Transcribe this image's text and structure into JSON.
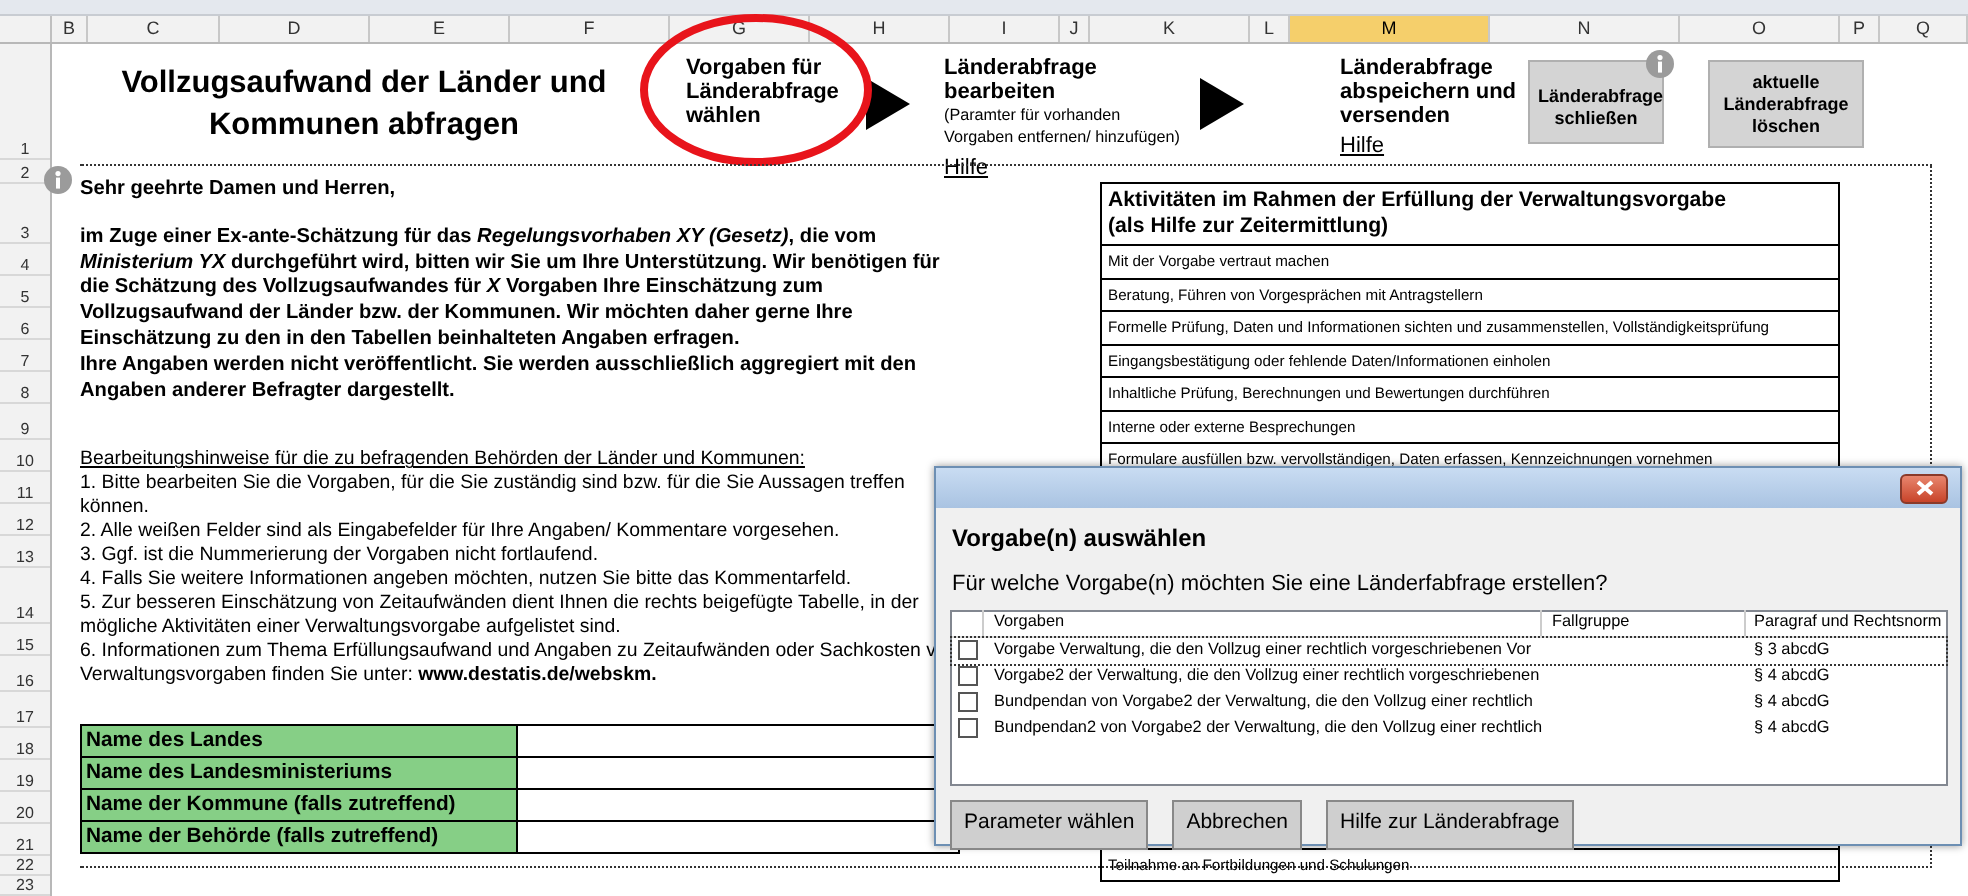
{
  "column_headers": [
    {
      "label": "B",
      "selected": false
    },
    {
      "label": "C",
      "selected": false
    },
    {
      "label": "D",
      "selected": false
    },
    {
      "label": "E",
      "selected": false
    },
    {
      "label": "F",
      "selected": false
    },
    {
      "label": "G",
      "selected": false
    },
    {
      "label": "H",
      "selected": false
    },
    {
      "label": "I",
      "selected": false
    },
    {
      "label": "J",
      "selected": false
    },
    {
      "label": "K",
      "selected": false
    },
    {
      "label": "L",
      "selected": false
    },
    {
      "label": "M",
      "selected": true
    },
    {
      "label": "N",
      "selected": false
    },
    {
      "label": "O",
      "selected": false
    },
    {
      "label": "P",
      "selected": false
    },
    {
      "label": "Q",
      "selected": false
    }
  ],
  "row_numbers": [
    "1",
    "2",
    "3",
    "4",
    "5",
    "6",
    "7",
    "8",
    "9",
    "10",
    "11",
    "12",
    "13",
    "14",
    "15",
    "16",
    "17",
    "18",
    "19",
    "20",
    "21",
    "22",
    "23"
  ],
  "header": {
    "title": "Vollzugsaufwand der Länder und Kommunen abfragen",
    "steps": [
      {
        "title": "Vorgaben für Länderabfrage wählen",
        "highlighted": true
      },
      {
        "title": "Länderabfrage bearbeiten",
        "subtitle": "(Paramter für vorhanden Vorgaben entfernen/ hinzufügen)",
        "link": "Hilfe",
        "highlighted": false
      },
      {
        "title": "Länderabfrage abspeichern und versenden",
        "link": "Hilfe",
        "highlighted": false
      }
    ],
    "buttons": [
      {
        "label": "Länderabfrage schließen",
        "info": true
      },
      {
        "label": "aktuelle Länderabfrage löschen",
        "info": false
      }
    ]
  },
  "letter": {
    "greeting": "Sehr geehrte Damen und Herren,",
    "lines": [
      "im Zuge einer Ex-ante-Schätzung für das *Regelungsvorhaben XY (Gesetz)*, die vom",
      "*Ministerium YX* durchgeführt wird, bitten wir Sie um Ihre Unterstützung. Wir benötigen für",
      "die Schätzung des Vollzugsaufwandes für *X* Vorgaben Ihre Einschätzung zum",
      "Vollzugsaufwand der Länder bzw. der Kommunen. Wir möchten daher gerne Ihre",
      "Einschätzung zu den in den Tabellen beinhalteten Angaben erfragen.",
      "Ihre Angaben werden nicht veröffentlicht. Sie werden ausschließlich aggregiert mit den",
      "Angaben anderer Befragter dargestellt."
    ]
  },
  "hints": {
    "heading": "Bearbeitungshinweise für die zu befragenden Behörden der Länder und Kommunen:",
    "lines": [
      "1. Bitte bearbeiten Sie die Vorgaben, für die Sie zuständig sind bzw. für die Sie Aussagen treffen",
      "können.",
      "2. Alle weißen Felder sind als Eingabefelder für Ihre Angaben/ Kommentare vorgesehen.",
      "3. Ggf. ist die Nummerierung der Vorgaben nicht fortlaufend.",
      "4. Falls Sie weitere Informationen angeben möchten, nutzen Sie bitte das Kommentarfeld.",
      "5. Zur besseren Einschätzung von Zeitaufwänden dient Ihnen die rechts beigefügte Tabelle, in der",
      "mögliche Aktivitäten einer Verwaltungsvorgabe aufgelistet sind.",
      "6. Informationen zum Thema Erfüllungsaufwand und Angaben zu Zeitaufwänden oder Sachkosten v",
      "Verwaltungsvorgaben finden Sie unter: **www.destatis.de/webskm.**"
    ]
  },
  "form_labels": [
    "Name des Landes",
    "Name des Landesministeriums",
    "Name der Kommune (falls zutreffend)",
    "Name der Behörde (falls zutreffend)"
  ],
  "activities": {
    "heading": [
      "Aktivitäten im Rahmen der Erfüllung der Verwaltungsvorgabe",
      "(als Hilfe zur Zeitermittlung)"
    ],
    "items": [
      "Mit der Vorgabe vertraut machen",
      "Beratung, Führen von Vorgesprächen mit Antragstellern",
      "Formelle Prüfung, Daten und Informationen sichten und zusammenstellen, Vollständigkeitsprüfung",
      "Eingangsbestätigung oder fehlende Daten/Informationen einholen",
      "Inhaltliche Prüfung, Berechnungen und Bewertungen durchführen",
      "Interne oder externe Besprechungen",
      "Formulare ausfüllen bzw. vervollständigen, Daten erfassen, Kennzeichnungen vornehmen"
    ],
    "last_item": "Teilnahme an Fortbildungen und Schulungen"
  },
  "dialog": {
    "heading": "Vorgabe(n) auswählen",
    "question": "Für welche Vorgabe(n) möchten Sie eine Länderfabfrage erstellen?",
    "columns": [
      "Vorgaben",
      "Fallgruppe",
      "Paragraf und Rechtsnorm"
    ],
    "rows": [
      {
        "vorgabe": "Vorgabe Verwaltung, die den Vollzug einer rechtlich vorgeschriebenen Vor",
        "norm": "§ 3 abcdG",
        "checked": false,
        "focused": true
      },
      {
        "vorgabe": "Vorgabe2 der Verwaltung, die den Vollzug einer rechtlich vorgeschriebenen",
        "norm": "§ 4 abcdG",
        "checked": false,
        "focused": false
      },
      {
        "vorgabe": "Bundpendan von Vorgabe2 der Verwaltung, die den Vollzug einer rechtlich",
        "norm": "§ 4 abcdG",
        "checked": false,
        "focused": false
      },
      {
        "vorgabe": "Bundpendan2 von Vorgabe2 der Verwaltung, die den Vollzug einer rechtlich",
        "norm": "§ 4 abcdG",
        "checked": false,
        "focused": false
      }
    ],
    "buttons": [
      "Parameter wählen",
      "Abbrechen",
      "Hilfe zur Länderabfrage"
    ]
  }
}
